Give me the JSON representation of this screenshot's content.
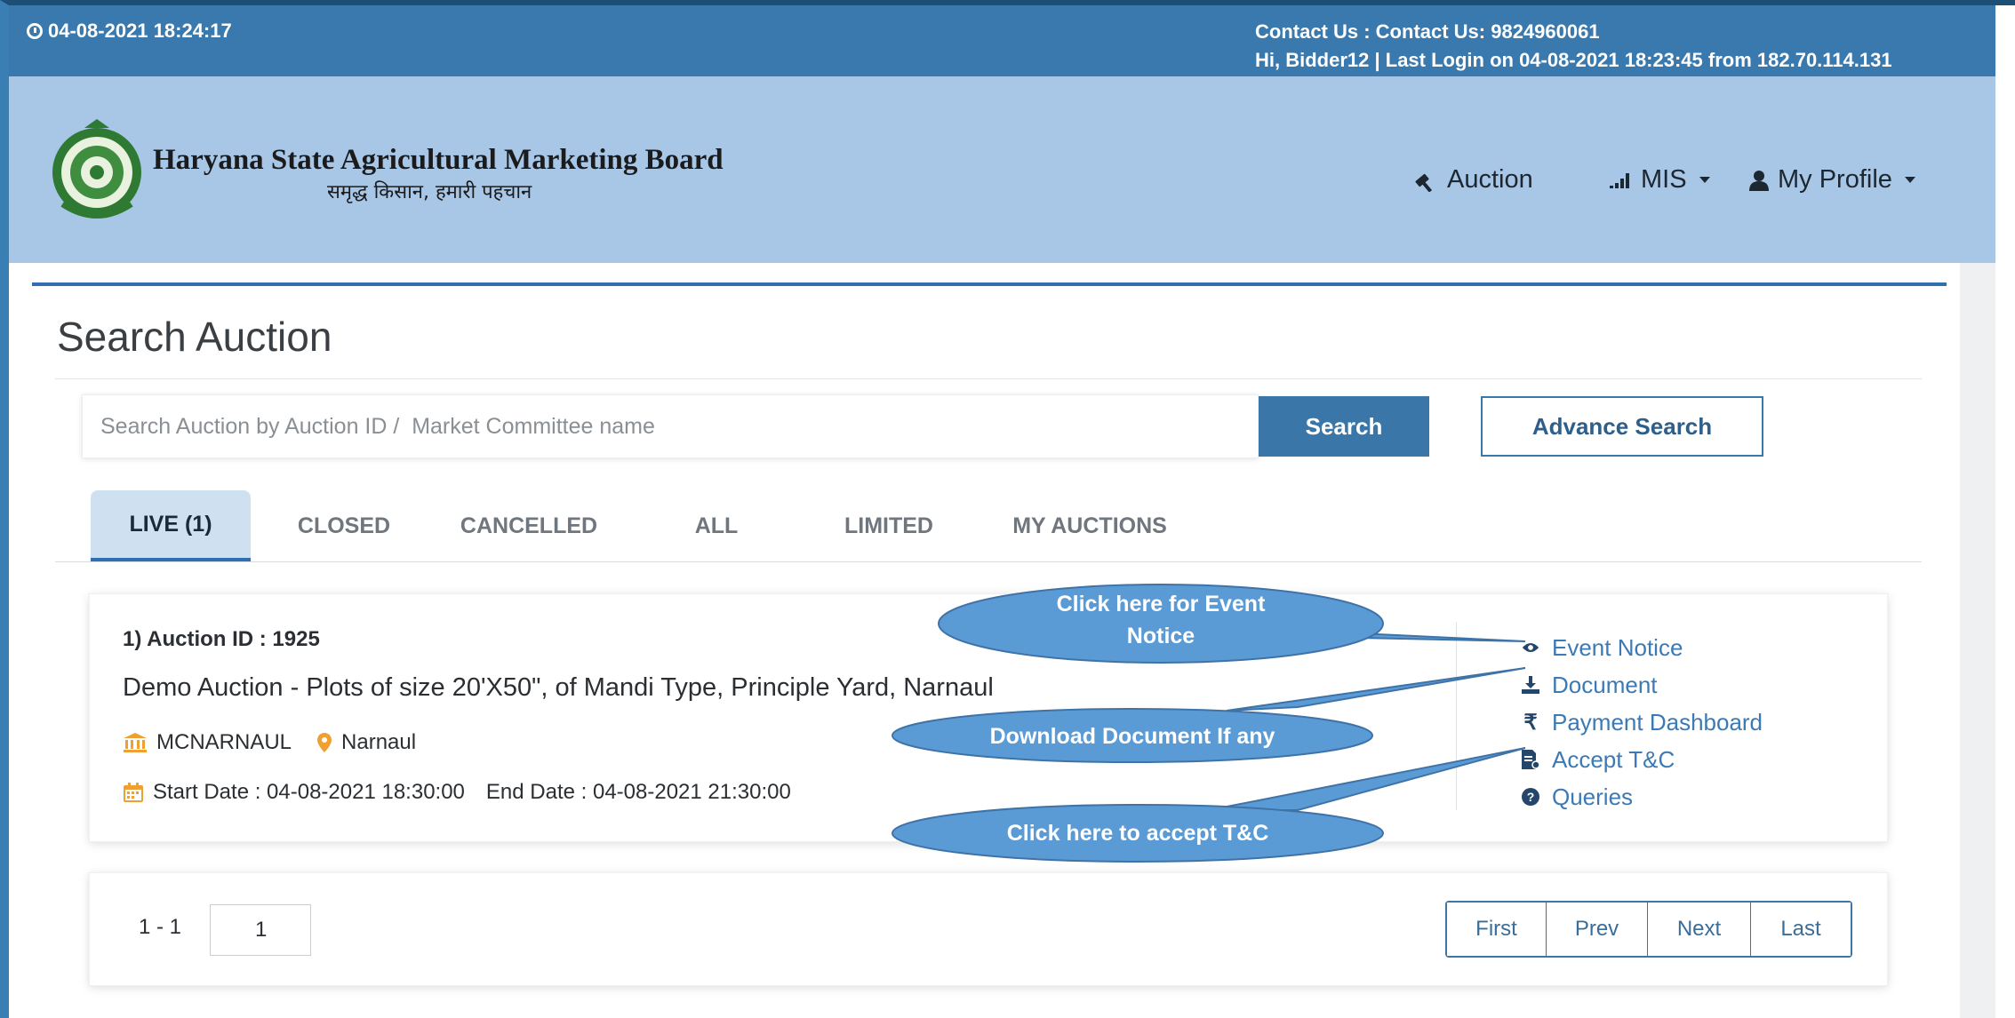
{
  "topbar": {
    "datetime": "04-08-2021 18:24:17",
    "contact": "Contact Us : Contact Us: 9824960061",
    "login_info": "Hi, Bidder12 | Last Login on 04-08-2021 18:23:45 from 182.70.114.131"
  },
  "brand": {
    "title": "Haryana State Agricultural Marketing Board",
    "subtitle": "समृद्ध किसान, हमारी पहचान"
  },
  "nav": {
    "auction": "Auction",
    "mis": "MIS",
    "profile": "My Profile"
  },
  "page": {
    "title": "Search Auction"
  },
  "search": {
    "placeholder": "Search Auction by Auction ID /  Market Committee name",
    "value": "",
    "search_label": "Search",
    "advance_label": "Advance Search"
  },
  "tabs": [
    {
      "label": "LIVE (1)",
      "active": true
    },
    {
      "label": "CLOSED",
      "active": false
    },
    {
      "label": "CANCELLED",
      "active": false
    },
    {
      "label": "ALL",
      "active": false
    },
    {
      "label": "LIMITED",
      "active": false
    },
    {
      "label": "MY AUCTIONS",
      "active": false
    }
  ],
  "auction": {
    "id_line": "1) Auction ID : 1925",
    "title": "Demo Auction - Plots of size 20'X50\", of Mandi Type, Principle Yard, Narnaul",
    "committee": "MCNARNAUL",
    "location": "Narnaul",
    "start": "Start Date : 04-08-2021 18:30:00",
    "end": "End Date : 04-08-2021 21:30:00",
    "actions": [
      {
        "label": "Event Notice",
        "icon": "eye-icon"
      },
      {
        "label": "Document",
        "icon": "download-icon"
      },
      {
        "label": "Payment Dashboard",
        "icon": "rupee-icon"
      },
      {
        "label": "Accept T&C",
        "icon": "file-sign-icon"
      },
      {
        "label": "Queries",
        "icon": "question-circle-icon"
      }
    ]
  },
  "pagination": {
    "range": "1 - 1",
    "page_value": "1",
    "first": "First",
    "prev": "Prev",
    "next": "Next",
    "last": "Last"
  },
  "callouts": {
    "event_notice": "Click here for Event Notice",
    "document": "Download Document If any",
    "accept_tc": "Click here to accept T&C"
  },
  "colors": {
    "topbar": "#3a79ad",
    "header": "#a8c7e7",
    "accent": "#3a76a8",
    "callout": "#5b9bd5",
    "link": "#3b7ab4",
    "icon_orange": "#f0a030"
  }
}
